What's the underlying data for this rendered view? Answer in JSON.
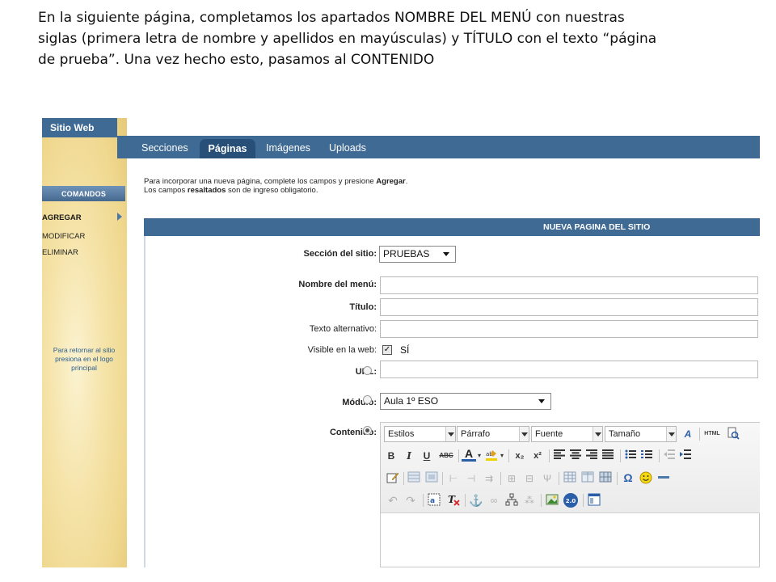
{
  "instructions": {
    "line1": "En la siguiente página, completamos los apartados NOMBRE DEL MENÚ con nuestras",
    "line2": "siglas (primera letra de nombre y apellidos en mayúsculas) y TÍTULO con el texto “página",
    "line3": "de prueba”. Una vez hecho esto,  pasamos al CONTENIDO"
  },
  "sidebar": {
    "title": "Sitio Web",
    "commands_header": "COMANDOS",
    "items": [
      "AGREGAR",
      "MODIFICAR",
      "ELIMINAR"
    ],
    "note_lines": [
      "Para retornar al sitio",
      "presiona en el logo",
      "principal"
    ]
  },
  "nav": {
    "items": [
      "Secciones",
      "Páginas",
      "Imágenes",
      "Uploads"
    ],
    "active": "Páginas"
  },
  "intro": {
    "line1_a": "Para incorporar una nueva página, complete los campos y presione ",
    "line1_b": "Agregar",
    "line1_c": ".",
    "line2_a": "Los campos ",
    "line2_b": "resaltados",
    "line2_c": " son de ingreso obligatorio."
  },
  "form": {
    "header": "NUEVA PAGINA DEL SITIO",
    "seccion_label": "Sección del sitio:",
    "seccion_value": "PRUEBAS",
    "nombre_label": "Nombre del menú:",
    "nombre_value": "",
    "titulo_label": "Título:",
    "titulo_value": "",
    "alt_label": "Texto alternativo:",
    "alt_value": "",
    "visible_label": "Visible en la web:",
    "visible_text": "SÍ",
    "url_label": "URL:",
    "url_value": "",
    "modulo_label": "Módulo:",
    "modulo_value": "Aula 1º ESO",
    "contenido_label": "Contenido:"
  },
  "editor": {
    "combos": [
      "Estilos",
      "Párrafo",
      "Fuente",
      "Tamaño"
    ],
    "html_label": "HTML",
    "bold": "B",
    "italic": "I",
    "underline": "U",
    "strike": "ABC",
    "font_color": "A",
    "sub": "x₂",
    "sup": "x²",
    "omega": "Ω",
    "badge": "2.0"
  },
  "colors": {
    "nav_blue": "#3e6a94",
    "nav_active": "#274f78",
    "sidebar_sand": "#f5e3a8"
  }
}
